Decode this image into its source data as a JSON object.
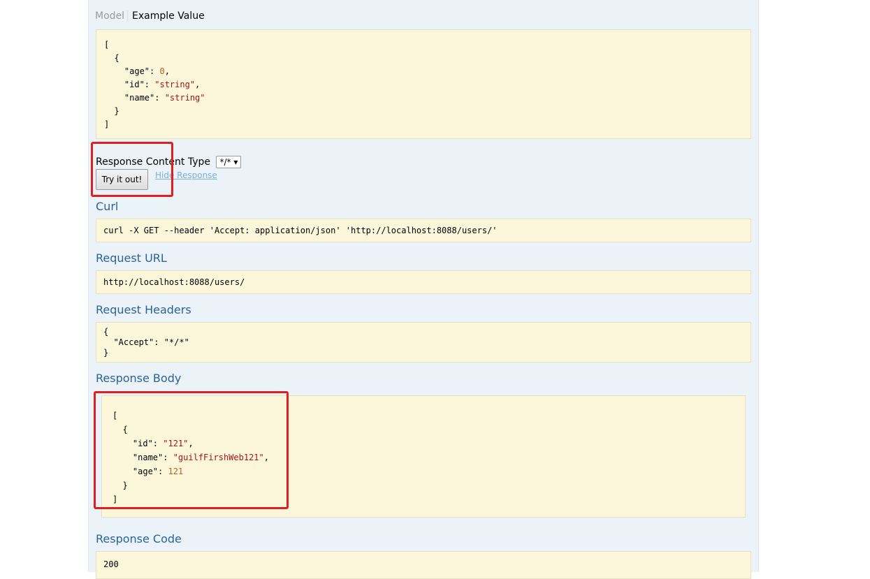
{
  "tabs": {
    "model": "Model",
    "example_value": "Example Value"
  },
  "example": {
    "open": "[",
    "obj_open": "  {",
    "age_key": "    \"age\": ",
    "age_val": "0",
    "age_comma": ",",
    "id_key": "    \"id\": ",
    "id_val": "\"string\"",
    "id_comma": ",",
    "name_key": "    \"name\": ",
    "name_val": "\"string\"",
    "obj_close": "  }",
    "close": "]"
  },
  "response_content_type": {
    "label": "Response Content Type",
    "selected": "*/*"
  },
  "try_button": "Try it out!",
  "hide_response": "Hide Response",
  "curl": {
    "title": "Curl",
    "value": "curl -X GET --header 'Accept: application/json' 'http://localhost:8088/users/'"
  },
  "request_url": {
    "title": "Request URL",
    "value": "http://localhost:8088/users/"
  },
  "request_headers": {
    "title": "Request Headers",
    "line1": "{",
    "line2": "  \"Accept\": \"*/*\"",
    "line3": "}"
  },
  "response_body": {
    "title": "Response Body",
    "open": "[",
    "obj_open": "  {",
    "id_key": "    \"id\": ",
    "id_val": "\"121\"",
    "id_comma": ",",
    "name_key": "    \"name\": ",
    "name_val": "\"guilfFirshWeb121\"",
    "name_comma": ",",
    "age_key": "    \"age\": ",
    "age_val": "121",
    "obj_close": "  }",
    "close": "]"
  },
  "response_code": {
    "title": "Response Code",
    "value": "200"
  },
  "colors": {
    "panel": "#ebf3f9",
    "code_bg": "#fcf6db",
    "title_blue": "#2b6297",
    "highlight_red": "#e02020"
  }
}
